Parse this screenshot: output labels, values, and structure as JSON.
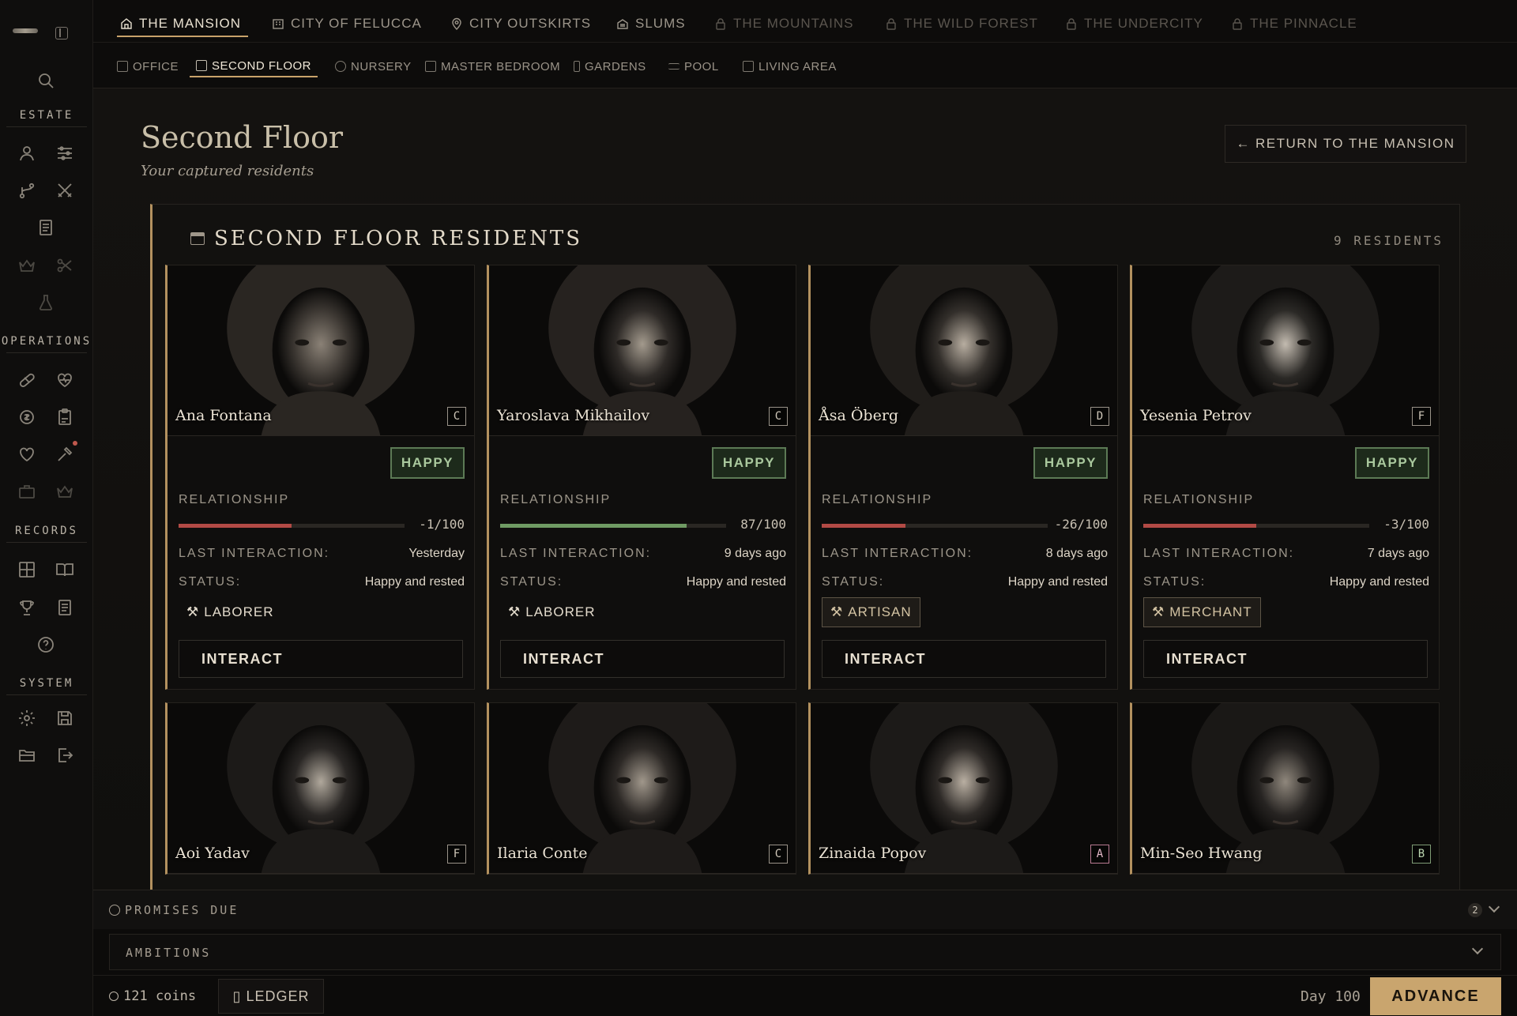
{
  "nav": {
    "tabs": [
      {
        "label": "THE MANSION",
        "state": "active",
        "icon": "home-icon"
      },
      {
        "label": "CITY OF FELUCCA",
        "state": "open",
        "icon": "building-icon"
      },
      {
        "label": "CITY OUTSKIRTS",
        "state": "open",
        "icon": "map-pin-icon"
      },
      {
        "label": "SLUMS",
        "state": "open",
        "icon": "shack-icon"
      },
      {
        "label": "THE MOUNTAINS",
        "state": "locked",
        "icon": "lock-icon"
      },
      {
        "label": "THE WILD FOREST",
        "state": "locked",
        "icon": "lock-icon"
      },
      {
        "label": "THE UNDERCITY",
        "state": "locked",
        "icon": "lock-icon"
      },
      {
        "label": "THE PINNACLE",
        "state": "locked",
        "icon": "lock-icon"
      }
    ],
    "subtabs": [
      {
        "label": "OFFICE"
      },
      {
        "label": "SECOND FLOOR",
        "active": true
      },
      {
        "label": "NURSERY"
      },
      {
        "label": "MASTER BEDROOM"
      },
      {
        "label": "GARDENS"
      },
      {
        "label": "POOL"
      },
      {
        "label": "LIVING AREA"
      }
    ]
  },
  "sidebar": {
    "sections": [
      "ESTATE",
      "OPERATIONS",
      "RECORDS",
      "SYSTEM"
    ]
  },
  "page": {
    "title": "Second Floor",
    "subtitle": "Your captured residents",
    "return_label": "RETURN TO THE MANSION"
  },
  "panel": {
    "title": "SECOND FLOOR RESIDENTS",
    "count": "9 RESIDENTS"
  },
  "labels": {
    "relationship": "RELATIONSHIP",
    "last_interaction": "LAST INTERACTION:",
    "status": "STATUS:",
    "interact": "INTERACT"
  },
  "residents": [
    {
      "name": "Ana Fontana",
      "grade": "C",
      "mood": "HAPPY",
      "relationship": "-1/100",
      "relationship_value": -1,
      "last": "Yesterday",
      "status": "Happy and rested",
      "job": "LABORER",
      "job_boxed": false
    },
    {
      "name": "Yaroslava Mikhailov",
      "grade": "C",
      "mood": "HAPPY",
      "relationship": "87/100",
      "relationship_value": 87,
      "last": "9 days ago",
      "status": "Happy and rested",
      "job": "LABORER",
      "job_boxed": false
    },
    {
      "name": "Åsa Öberg",
      "grade": "D",
      "mood": "HAPPY",
      "relationship": "-26/100",
      "relationship_value": -26,
      "last": "8 days ago",
      "status": "Happy and rested",
      "job": "ARTISAN",
      "job_boxed": true
    },
    {
      "name": "Yesenia Petrov",
      "grade": "F",
      "mood": "HAPPY",
      "relationship": "-3/100",
      "relationship_value": -3,
      "last": "7 days ago",
      "status": "Happy and rested",
      "job": "MERCHANT",
      "job_boxed": true
    },
    {
      "name": "Aoi Yadav",
      "grade": "F"
    },
    {
      "name": "Ilaria Conte",
      "grade": "C"
    },
    {
      "name": "Zinaida Popov",
      "grade": "A"
    },
    {
      "name": "Min-Seo Hwang",
      "grade": "B"
    }
  ],
  "bottom": {
    "promises": "PROMISES DUE",
    "promises_count": "2",
    "ambitions": "AMBITIONS",
    "coins": "121 coins",
    "ledger": "LEDGER",
    "day": "Day 100",
    "advance": "ADVANCE"
  },
  "colors": {
    "accent": "#c9a56e",
    "happy": "#a9c89d",
    "rel_positive": "#6f9a63",
    "rel_negative": "#b24a45"
  }
}
